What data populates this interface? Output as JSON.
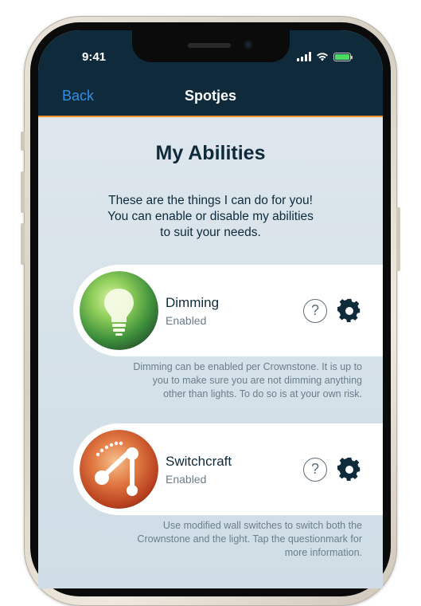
{
  "status_bar": {
    "time": "9:41"
  },
  "nav": {
    "back_label": "Back",
    "title": "Spotjes"
  },
  "page": {
    "title": "My Abilities",
    "intro_lines": [
      "These are the things I can do for you!",
      "You can enable or disable my abilities",
      "to suit your needs."
    ]
  },
  "abilities": [
    {
      "name": "Dimming",
      "status": "Enabled",
      "help_label": "?",
      "description_lines": [
        "Dimming can be enabled per Crownstone. It is up to",
        "you to make sure you are not dimming anything",
        "other than lights. To do so is at your own risk."
      ],
      "icon": "lightbulb-icon",
      "color": "#5fb84a"
    },
    {
      "name": "Switchcraft",
      "status": "Enabled",
      "help_label": "?",
      "description_lines": [
        "Use modified wall switches to switch both the",
        "Crownstone and the light. Tap the questionmark for",
        "more information."
      ],
      "icon": "switchcraft-icon",
      "color": "#d4572b"
    }
  ],
  "colors": {
    "navbar": "#0f2a3a",
    "accent_line": "#f3922b",
    "back_link": "#2f8fe6",
    "battery": "#4cd964"
  }
}
